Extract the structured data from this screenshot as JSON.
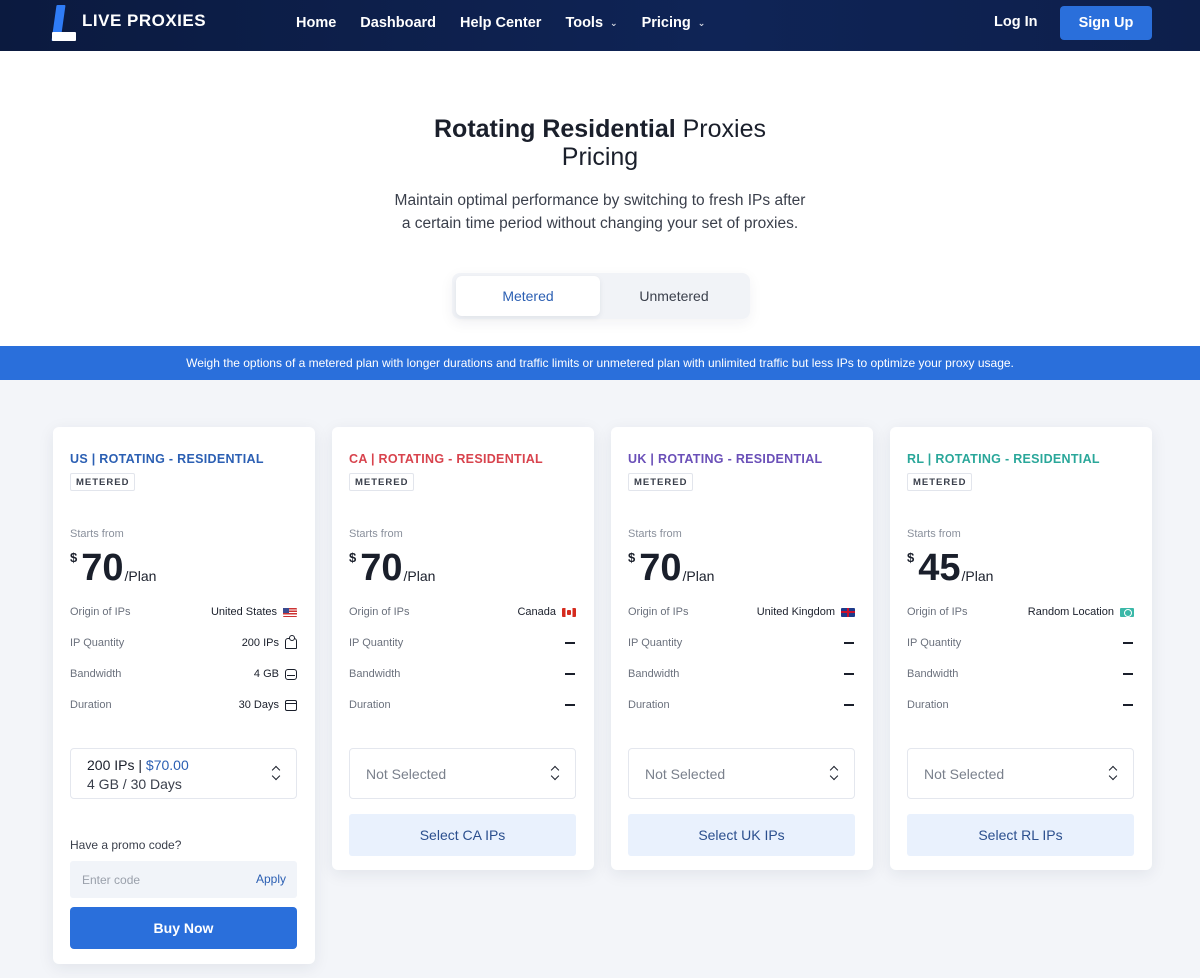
{
  "nav": {
    "logo": "LIVE PROXIES",
    "links": [
      "Home",
      "Dashboard",
      "Help Center",
      "Tools",
      "Pricing"
    ],
    "login": "Log In",
    "signup": "Sign Up"
  },
  "hero": {
    "title_bold": "Rotating Residential",
    "title_rest": " Proxies",
    "title_line2": "Pricing",
    "subtitle_line1": "Maintain optimal performance by switching to fresh IPs after",
    "subtitle_line2": "a certain time period without changing your set of proxies.",
    "toggle": [
      "Metered",
      "Unmetered"
    ]
  },
  "banner": "Weigh the options of a metered plan with longer durations and traffic limits or unmetered plan with unlimited traffic but less IPs to optimize your proxy usage.",
  "labels": {
    "starts_from": "Starts from",
    "currency": "$",
    "per_plan": "/Plan",
    "origin": "Origin of IPs",
    "quantity": "IP Quantity",
    "bandwidth": "Bandwidth",
    "duration": "Duration",
    "not_selected": "Not Selected",
    "promo_question": "Have a promo code?",
    "promo_placeholder": "Enter code",
    "apply": "Apply",
    "buy_now": "Buy Now"
  },
  "cards": [
    {
      "title": "US | ROTATING - RESIDENTIAL",
      "title_color": "#2b5fb3",
      "badge": "METERED",
      "price": "70",
      "origin": "United States",
      "quantity": "200 IPs",
      "bandwidth": "4 GB",
      "duration": "30 Days",
      "selected_line1_a": "200 IPs | ",
      "selected_line1_b": "$70.00",
      "selected_line2": "4 GB / 30 Days"
    },
    {
      "title": "CA | ROTATING - RESIDENTIAL",
      "title_color": "#d8434d",
      "badge": "METERED",
      "price": "70",
      "origin": "Canada",
      "select_button": "Select CA IPs"
    },
    {
      "title": "UK | ROTATING - RESIDENTIAL",
      "title_color": "#6a4fb8",
      "badge": "METERED",
      "price": "70",
      "origin": "United Kingdom",
      "select_button": "Select UK IPs"
    },
    {
      "title": "RL | ROTATING - RESIDENTIAL",
      "title_color": "#2aa79a",
      "badge": "METERED",
      "price": "45",
      "origin": "Random Location",
      "select_button": "Select RL IPs"
    }
  ],
  "colors": {
    "accent": "#2a6fdb",
    "nav_bg": "#0d1f4b"
  }
}
